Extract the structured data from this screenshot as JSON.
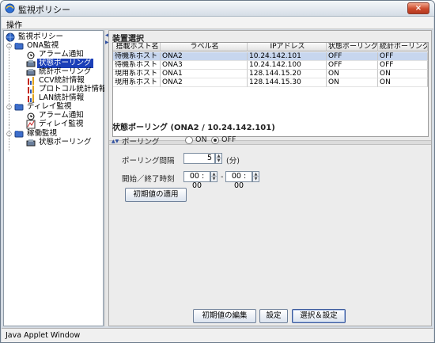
{
  "window": {
    "title": "監視ポリシー",
    "close_glyph": "×"
  },
  "menubar": {
    "items": [
      {
        "label": "操作"
      }
    ]
  },
  "tree": {
    "nodes": [
      {
        "label": "監視ポリシー",
        "icon": "globe-icon"
      },
      {
        "label": "ONA監視",
        "icon": "folder-icon"
      },
      {
        "label": "アラーム通知",
        "icon": "alarm-clock-icon"
      },
      {
        "label": "状態ポーリング",
        "icon": "device-icon",
        "selected": true
      },
      {
        "label": "統計ポーリング",
        "icon": "device-icon"
      },
      {
        "label": "CCV統計情報",
        "icon": "bar-chart-icon"
      },
      {
        "label": "プロトコル統計情報",
        "icon": "bar-chart-icon"
      },
      {
        "label": "LAN統計情報",
        "icon": "bar-chart-icon"
      },
      {
        "label": "ディレイ監視",
        "icon": "folder-icon"
      },
      {
        "label": "アラーム通知",
        "icon": "alarm-clock-icon"
      },
      {
        "label": "ディレイ監視",
        "icon": "delay-graph-icon"
      },
      {
        "label": "稼働監視",
        "icon": "folder-icon"
      },
      {
        "label": "状態ポーリング",
        "icon": "device-icon"
      }
    ]
  },
  "device_selection": {
    "title": "装置選択",
    "columns": [
      "搭載ホスト名",
      "ラベル名",
      "IPアドレス",
      "状態ポーリング",
      "統計ポーリング"
    ],
    "rows": [
      [
        "待機系ホスト",
        "ONA2",
        "10.24.142.101",
        "OFF",
        "OFF"
      ],
      [
        "待機系ホスト",
        "ONA3",
        "10.24.142.100",
        "OFF",
        "OFF"
      ],
      [
        "現用系ホスト",
        "ONA1",
        "128.144.15.20",
        "ON",
        "ON"
      ],
      [
        "現用系ホスト",
        "ONA2",
        "128.144.15.30",
        "ON",
        "ON"
      ]
    ],
    "selected_row": 0
  },
  "status_polling": {
    "title": "状態ポーリング (ONA2 / 10.24.142.101)",
    "polling_label": "ポーリング",
    "on_label": "ON",
    "off_label": "OFF",
    "selected_option": "OFF",
    "interval_label": "ポーリング間隔",
    "interval_value": "5",
    "interval_unit": "(分)",
    "time_label": "開始／終了時刻",
    "start_time": "00 : 00",
    "end_time": "00 : 00",
    "time_separator": "-",
    "apply_default_button": "初期値の適用"
  },
  "footer_buttons": {
    "edit_default": "初期値の編集",
    "set": "設定",
    "select_and_set": "選択＆設定"
  },
  "statusbar": {
    "text": "Java Applet Window"
  }
}
